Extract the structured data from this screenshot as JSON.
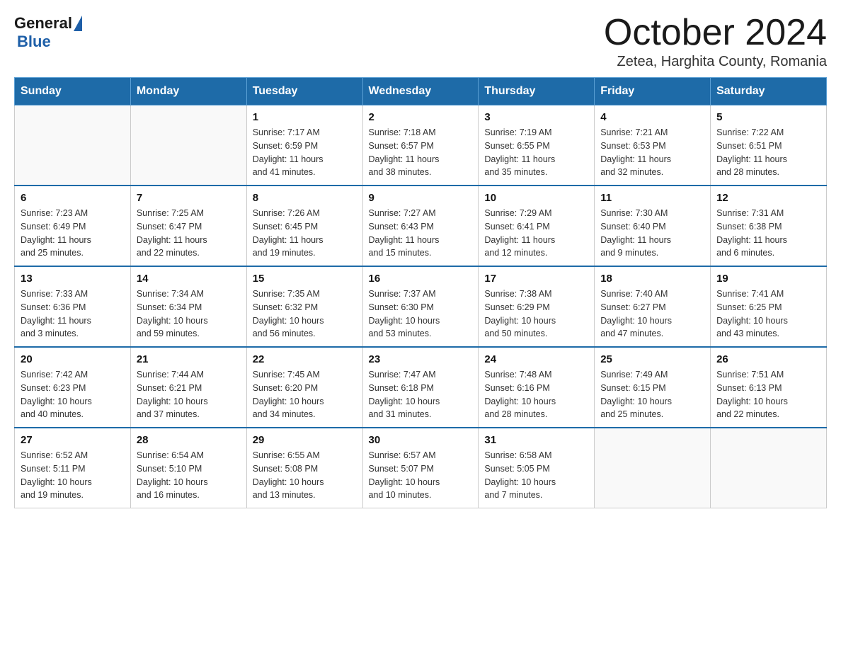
{
  "header": {
    "logo": {
      "general": "General",
      "blue": "Blue"
    },
    "title": "October 2024",
    "location": "Zetea, Harghita County, Romania"
  },
  "days": [
    "Sunday",
    "Monday",
    "Tuesday",
    "Wednesday",
    "Thursday",
    "Friday",
    "Saturday"
  ],
  "weeks": [
    [
      {
        "day": null,
        "info": null
      },
      {
        "day": null,
        "info": null
      },
      {
        "day": "1",
        "info": "Sunrise: 7:17 AM\nSunset: 6:59 PM\nDaylight: 11 hours\nand 41 minutes."
      },
      {
        "day": "2",
        "info": "Sunrise: 7:18 AM\nSunset: 6:57 PM\nDaylight: 11 hours\nand 38 minutes."
      },
      {
        "day": "3",
        "info": "Sunrise: 7:19 AM\nSunset: 6:55 PM\nDaylight: 11 hours\nand 35 minutes."
      },
      {
        "day": "4",
        "info": "Sunrise: 7:21 AM\nSunset: 6:53 PM\nDaylight: 11 hours\nand 32 minutes."
      },
      {
        "day": "5",
        "info": "Sunrise: 7:22 AM\nSunset: 6:51 PM\nDaylight: 11 hours\nand 28 minutes."
      }
    ],
    [
      {
        "day": "6",
        "info": "Sunrise: 7:23 AM\nSunset: 6:49 PM\nDaylight: 11 hours\nand 25 minutes."
      },
      {
        "day": "7",
        "info": "Sunrise: 7:25 AM\nSunset: 6:47 PM\nDaylight: 11 hours\nand 22 minutes."
      },
      {
        "day": "8",
        "info": "Sunrise: 7:26 AM\nSunset: 6:45 PM\nDaylight: 11 hours\nand 19 minutes."
      },
      {
        "day": "9",
        "info": "Sunrise: 7:27 AM\nSunset: 6:43 PM\nDaylight: 11 hours\nand 15 minutes."
      },
      {
        "day": "10",
        "info": "Sunrise: 7:29 AM\nSunset: 6:41 PM\nDaylight: 11 hours\nand 12 minutes."
      },
      {
        "day": "11",
        "info": "Sunrise: 7:30 AM\nSunset: 6:40 PM\nDaylight: 11 hours\nand 9 minutes."
      },
      {
        "day": "12",
        "info": "Sunrise: 7:31 AM\nSunset: 6:38 PM\nDaylight: 11 hours\nand 6 minutes."
      }
    ],
    [
      {
        "day": "13",
        "info": "Sunrise: 7:33 AM\nSunset: 6:36 PM\nDaylight: 11 hours\nand 3 minutes."
      },
      {
        "day": "14",
        "info": "Sunrise: 7:34 AM\nSunset: 6:34 PM\nDaylight: 10 hours\nand 59 minutes."
      },
      {
        "day": "15",
        "info": "Sunrise: 7:35 AM\nSunset: 6:32 PM\nDaylight: 10 hours\nand 56 minutes."
      },
      {
        "day": "16",
        "info": "Sunrise: 7:37 AM\nSunset: 6:30 PM\nDaylight: 10 hours\nand 53 minutes."
      },
      {
        "day": "17",
        "info": "Sunrise: 7:38 AM\nSunset: 6:29 PM\nDaylight: 10 hours\nand 50 minutes."
      },
      {
        "day": "18",
        "info": "Sunrise: 7:40 AM\nSunset: 6:27 PM\nDaylight: 10 hours\nand 47 minutes."
      },
      {
        "day": "19",
        "info": "Sunrise: 7:41 AM\nSunset: 6:25 PM\nDaylight: 10 hours\nand 43 minutes."
      }
    ],
    [
      {
        "day": "20",
        "info": "Sunrise: 7:42 AM\nSunset: 6:23 PM\nDaylight: 10 hours\nand 40 minutes."
      },
      {
        "day": "21",
        "info": "Sunrise: 7:44 AM\nSunset: 6:21 PM\nDaylight: 10 hours\nand 37 minutes."
      },
      {
        "day": "22",
        "info": "Sunrise: 7:45 AM\nSunset: 6:20 PM\nDaylight: 10 hours\nand 34 minutes."
      },
      {
        "day": "23",
        "info": "Sunrise: 7:47 AM\nSunset: 6:18 PM\nDaylight: 10 hours\nand 31 minutes."
      },
      {
        "day": "24",
        "info": "Sunrise: 7:48 AM\nSunset: 6:16 PM\nDaylight: 10 hours\nand 28 minutes."
      },
      {
        "day": "25",
        "info": "Sunrise: 7:49 AM\nSunset: 6:15 PM\nDaylight: 10 hours\nand 25 minutes."
      },
      {
        "day": "26",
        "info": "Sunrise: 7:51 AM\nSunset: 6:13 PM\nDaylight: 10 hours\nand 22 minutes."
      }
    ],
    [
      {
        "day": "27",
        "info": "Sunrise: 6:52 AM\nSunset: 5:11 PM\nDaylight: 10 hours\nand 19 minutes."
      },
      {
        "day": "28",
        "info": "Sunrise: 6:54 AM\nSunset: 5:10 PM\nDaylight: 10 hours\nand 16 minutes."
      },
      {
        "day": "29",
        "info": "Sunrise: 6:55 AM\nSunset: 5:08 PM\nDaylight: 10 hours\nand 13 minutes."
      },
      {
        "day": "30",
        "info": "Sunrise: 6:57 AM\nSunset: 5:07 PM\nDaylight: 10 hours\nand 10 minutes."
      },
      {
        "day": "31",
        "info": "Sunrise: 6:58 AM\nSunset: 5:05 PM\nDaylight: 10 hours\nand 7 minutes."
      },
      {
        "day": null,
        "info": null
      },
      {
        "day": null,
        "info": null
      }
    ]
  ]
}
